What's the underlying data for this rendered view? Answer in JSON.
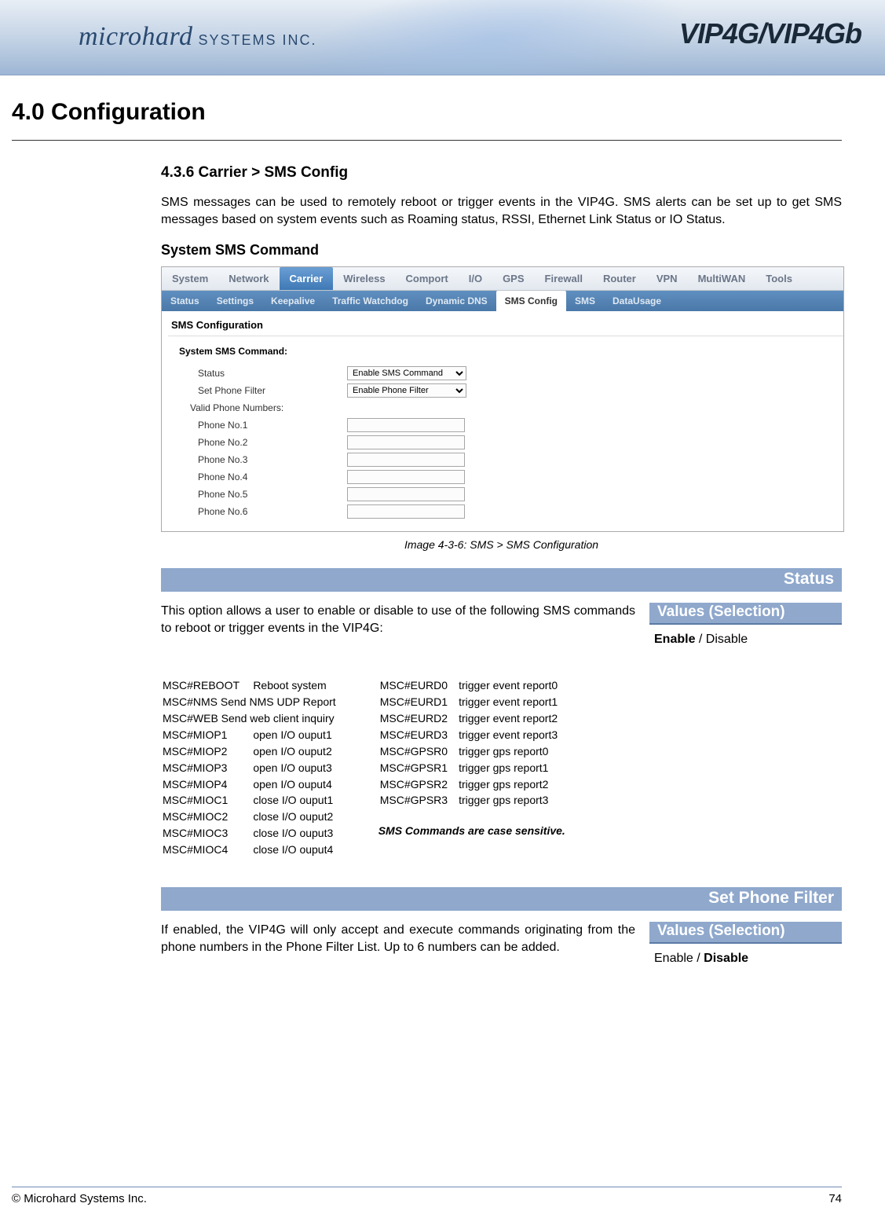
{
  "brand_left_main": "microhard",
  "brand_left_tail": " SYSTEMS INC.",
  "brand_right": "VIP4G/VIP4Gb",
  "chapter_title": "4.0  Configuration",
  "section_title": "4.3.6 Carrier > SMS Config",
  "intro_para": "SMS messages can be used to remotely reboot or trigger events in the VIP4G. SMS alerts can be set up to get SMS messages based on system events such as Roaming status, RSSI,  Ethernet Link Status or IO Status.",
  "sub_heading": "System SMS Command",
  "shot": {
    "tabs1": [
      "System",
      "Network",
      "Carrier",
      "Wireless",
      "Comport",
      "I/O",
      "GPS",
      "Firewall",
      "Router",
      "VPN",
      "MultiWAN",
      "Tools"
    ],
    "tabs1_active": 2,
    "tabs2": [
      "Status",
      "Settings",
      "Keepalive",
      "Traffic Watchdog",
      "Dynamic DNS",
      "SMS Config",
      "SMS",
      "DataUsage"
    ],
    "tabs2_active": 5,
    "panel_title": "SMS Configuration",
    "group_title": "System SMS Command:",
    "rows": {
      "status_label": "Status",
      "status_value": "Enable SMS Command",
      "filter_label": "Set Phone Filter",
      "filter_value": "Enable Phone Filter",
      "valid_label": "Valid Phone Numbers:",
      "phone1": "Phone No.1",
      "phone2": "Phone No.2",
      "phone3": "Phone No.3",
      "phone4": "Phone No.4",
      "phone5": "Phone No.5",
      "phone6": "Phone No.6"
    }
  },
  "caption": "Image 4-3-6:  SMS  > SMS Configuration",
  "status_bar": "Status",
  "status_desc": "This option allows a user to enable or disable to use of the following SMS commands to reboot or trigger events in the VIP4G:",
  "values_header": "Values (Selection)",
  "status_value_bold": "Enable",
  "status_value_rest": " / Disable",
  "cmds_left": [
    [
      "MSC#REBOOT",
      "Reboot system"
    ],
    [
      "MSC#NMS Send NMS UDP Report",
      ""
    ],
    [
      "MSC#WEB Send web client inquiry",
      ""
    ],
    [
      "MSC#MIOP1",
      "open I/O ouput1"
    ],
    [
      "MSC#MIOP2",
      "open I/O ouput2"
    ],
    [
      "MSC#MIOP3",
      "open I/O ouput3"
    ],
    [
      "MSC#MIOP4",
      "open I/O ouput4"
    ],
    [
      "MSC#MIOC1",
      "close I/O ouput1"
    ],
    [
      "MSC#MIOC2",
      "close I/O ouput2"
    ],
    [
      "MSC#MIOC3",
      "close I/O ouput3"
    ],
    [
      "MSC#MIOC4",
      "close I/O ouput4"
    ]
  ],
  "cmds_right": [
    [
      "MSC#EURD0",
      "trigger event report0"
    ],
    [
      "MSC#EURD1",
      "trigger event report1"
    ],
    [
      "MSC#EURD2",
      "trigger event report2"
    ],
    [
      "MSC#EURD3",
      "trigger event report3"
    ],
    [
      "MSC#GPSR0",
      "trigger gps report0"
    ],
    [
      "MSC#GPSR1",
      "trigger gps report1"
    ],
    [
      "MSC#GPSR2",
      "trigger gps report2"
    ],
    [
      "MSC#GPSR3",
      "trigger gps report3"
    ]
  ],
  "cmds_note": "SMS Commands are case sensitive.",
  "filter_bar": "Set Phone Filter",
  "filter_desc": "If enabled, the VIP4G will only accept and execute commands originating from the phone numbers in the Phone Filter List. Up to 6 numbers can be added.",
  "filter_value_pre": "Enable / ",
  "filter_value_bold": "Disable",
  "footer_left": "© Microhard Systems Inc.",
  "footer_right": "74"
}
